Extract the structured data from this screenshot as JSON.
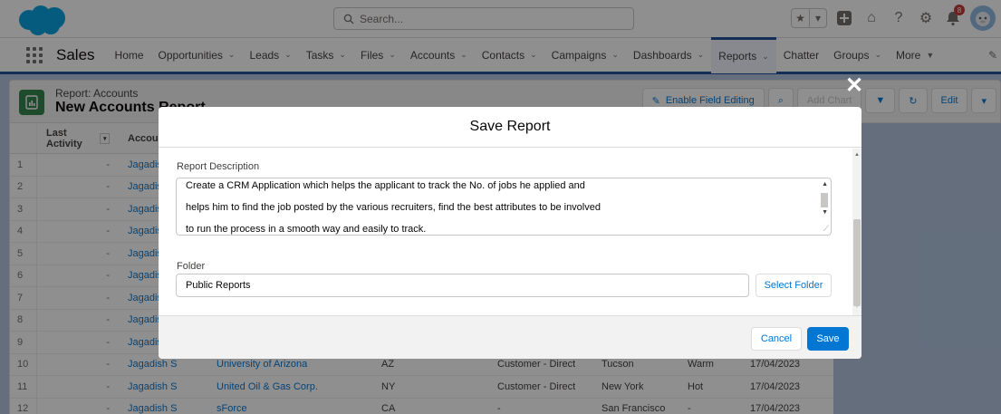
{
  "header": {
    "search_placeholder": "Search...",
    "notification_count": "8"
  },
  "nav": {
    "app_name": "Sales",
    "items": [
      {
        "label": "Home",
        "chevron": false
      },
      {
        "label": "Opportunities",
        "chevron": true
      },
      {
        "label": "Leads",
        "chevron": true
      },
      {
        "label": "Tasks",
        "chevron": true
      },
      {
        "label": "Files",
        "chevron": true
      },
      {
        "label": "Accounts",
        "chevron": true
      },
      {
        "label": "Contacts",
        "chevron": true
      },
      {
        "label": "Campaigns",
        "chevron": true
      },
      {
        "label": "Dashboards",
        "chevron": true
      },
      {
        "label": "Reports",
        "chevron": true,
        "active": true
      },
      {
        "label": "Chatter",
        "chevron": false
      },
      {
        "label": "Groups",
        "chevron": true
      },
      {
        "label": "More",
        "chevron": true
      }
    ]
  },
  "page": {
    "report_type": "Report: Accounts",
    "report_title": "New Accounts Report",
    "buttons": {
      "enable_field_editing": "Enable Field Editing",
      "add_chart": "Add Chart",
      "edit": "Edit"
    }
  },
  "table": {
    "headers": {
      "last_activity": "Last Activity",
      "account_owner": "Account O"
    },
    "rows": [
      {
        "num": "1",
        "activity": "-",
        "owner": "Jagadish S",
        "account": "",
        "state": "",
        "type": "",
        "city": "",
        "rating": "",
        "date": ""
      },
      {
        "num": "2",
        "activity": "-",
        "owner": "Jagadish S",
        "account": "",
        "state": "",
        "type": "",
        "city": "",
        "rating": "",
        "date": ""
      },
      {
        "num": "3",
        "activity": "-",
        "owner": "Jagadish S",
        "account": "",
        "state": "",
        "type": "",
        "city": "",
        "rating": "",
        "date": ""
      },
      {
        "num": "4",
        "activity": "-",
        "owner": "Jagadish S",
        "account": "",
        "state": "",
        "type": "",
        "city": "",
        "rating": "",
        "date": ""
      },
      {
        "num": "5",
        "activity": "-",
        "owner": "Jagadish S",
        "account": "",
        "state": "",
        "type": "",
        "city": "",
        "rating": "",
        "date": ""
      },
      {
        "num": "6",
        "activity": "-",
        "owner": "Jagadish S",
        "account": "",
        "state": "",
        "type": "",
        "city": "",
        "rating": "",
        "date": ""
      },
      {
        "num": "7",
        "activity": "-",
        "owner": "Jagadish S",
        "account": "",
        "state": "",
        "type": "",
        "city": "",
        "rating": "",
        "date": ""
      },
      {
        "num": "8",
        "activity": "-",
        "owner": "Jagadish S",
        "account": "",
        "state": "",
        "type": "",
        "city": "",
        "rating": "",
        "date": ""
      },
      {
        "num": "9",
        "activity": "-",
        "owner": "Jagadish S",
        "account": "",
        "state": "",
        "type": "",
        "city": "",
        "rating": "",
        "date": ""
      },
      {
        "num": "10",
        "activity": "-",
        "owner": "Jagadish S",
        "account": "University of Arizona",
        "state": "AZ",
        "type": "Customer - Direct",
        "city": "Tucson",
        "rating": "Warm",
        "date": "17/04/2023"
      },
      {
        "num": "11",
        "activity": "-",
        "owner": "Jagadish S",
        "account": "United Oil & Gas Corp.",
        "state": "NY",
        "type": "Customer - Direct",
        "city": "New York",
        "rating": "Hot",
        "date": "17/04/2023"
      },
      {
        "num": "12",
        "activity": "-",
        "owner": "Jagadish S",
        "account": "sForce",
        "state": "CA",
        "type": "-",
        "city": "San Francisco",
        "rating": "-",
        "date": "17/04/2023"
      }
    ]
  },
  "modal": {
    "title": "Save Report",
    "description_label": "Report Description",
    "description_lines": [
      "Create a CRM Application which helps the applicant to track the No. of jobs he applied and",
      "helps him to find the job posted by the various recruiters, find the best attributes to be involved",
      "to run the process in a smooth way and easily to track."
    ],
    "folder_label": "Folder",
    "folder_value": "Public Reports",
    "select_folder": "Select Folder",
    "cancel": "Cancel",
    "save": "Save"
  },
  "colors": {
    "brand_blue": "#0176d3",
    "nav_active": "#1b5297",
    "report_icon": "#2e844a"
  }
}
